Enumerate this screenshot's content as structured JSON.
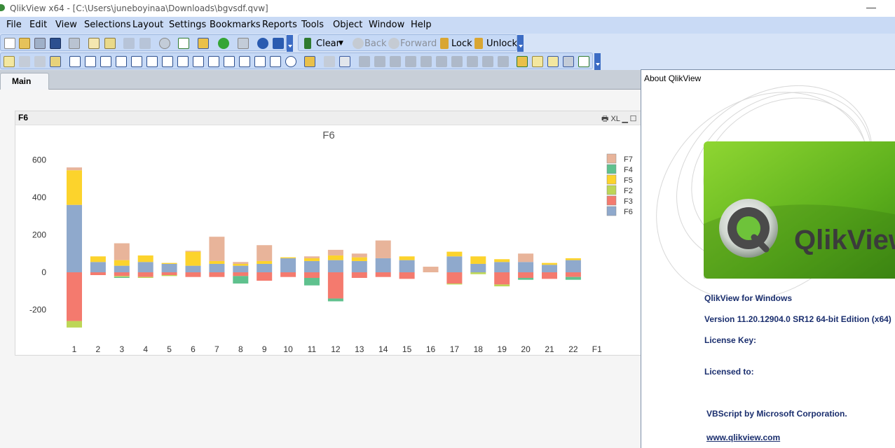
{
  "window": {
    "title": "QlikView x64 - [C:\\Users\\juneboyinaa\\Downloads\\bgvsdf.qvw]",
    "minimize": "—"
  },
  "menu": [
    "File",
    "Edit",
    "View",
    "Selections",
    "Layout",
    "Settings",
    "Bookmarks",
    "Reports",
    "Tools",
    "Object",
    "Window",
    "Help"
  ],
  "toolbar": {
    "clear": "Clear",
    "back": "Back",
    "forward": "Forward",
    "lock": "Lock",
    "unlock": "Unlock"
  },
  "tabs": {
    "active": "Main"
  },
  "chart_box": {
    "caption": "F6",
    "caption_icons": "🖶 XL ▁ ☐"
  },
  "chart_data": {
    "type": "bar",
    "stacked": true,
    "title": "F6",
    "categories": [
      "1",
      "2",
      "3",
      "4",
      "5",
      "6",
      "7",
      "8",
      "9",
      "10",
      "11",
      "12",
      "13",
      "14",
      "15",
      "16",
      "17",
      "18",
      "19",
      "20",
      "21",
      "22",
      "F1"
    ],
    "ylim": [
      -300,
      650
    ],
    "yticks": [
      600,
      400,
      200,
      0,
      -200
    ],
    "legend_position": "top-right",
    "series": [
      {
        "name": "F6",
        "color": "#8fa9cc",
        "values": [
          360,
          55,
          35,
          55,
          45,
          35,
          45,
          35,
          45,
          75,
          60,
          65,
          60,
          75,
          65,
          0,
          85,
          45,
          55,
          55,
          40,
          65,
          0
        ]
      },
      {
        "name": "F3",
        "color": "#f47a6e",
        "values": [
          -260,
          -15,
          -20,
          -25,
          -15,
          -25,
          -25,
          -20,
          -45,
          -25,
          -30,
          -140,
          -30,
          -25,
          -35,
          0,
          -60,
          0,
          -65,
          -30,
          -35,
          -25,
          0
        ]
      },
      {
        "name": "F2",
        "color": "#bdd657",
        "values": [
          -35,
          0,
          -5,
          -5,
          -5,
          0,
          0,
          0,
          0,
          0,
          0,
          0,
          0,
          0,
          0,
          0,
          -5,
          -10,
          -10,
          0,
          0,
          0,
          0
        ]
      },
      {
        "name": "F5",
        "color": "#fcd32c",
        "values": [
          185,
          30,
          30,
          35,
          5,
          75,
          15,
          10,
          15,
          5,
          15,
          25,
          20,
          0,
          20,
          0,
          25,
          40,
          15,
          0,
          10,
          10,
          0
        ]
      },
      {
        "name": "F4",
        "color": "#5fc18e",
        "values": [
          0,
          0,
          -5,
          0,
          0,
          0,
          0,
          -40,
          0,
          0,
          -40,
          -15,
          0,
          0,
          0,
          0,
          0,
          0,
          0,
          -10,
          0,
          -15,
          0
        ]
      },
      {
        "name": "F7",
        "color": "#e8b49a",
        "values": [
          15,
          0,
          90,
          0,
          0,
          5,
          130,
          10,
          85,
          0,
          10,
          30,
          20,
          95,
          0,
          30,
          0,
          0,
          0,
          45,
          0,
          0,
          0
        ]
      }
    ],
    "legend_order": [
      "F7",
      "F4",
      "F5",
      "F2",
      "F3",
      "F6"
    ]
  },
  "about": {
    "header": "About QlikView",
    "logo_text": "QlikView",
    "product": "QlikView for Windows",
    "version": "Version 11.20.12904.0 SR12 64-bit Edition (x64)",
    "license_key": "License Key:",
    "licensed_to": "Licensed to:",
    "vbscript": "VBScript by Microsoft Corporation.",
    "website": "www.qlikview.com"
  }
}
